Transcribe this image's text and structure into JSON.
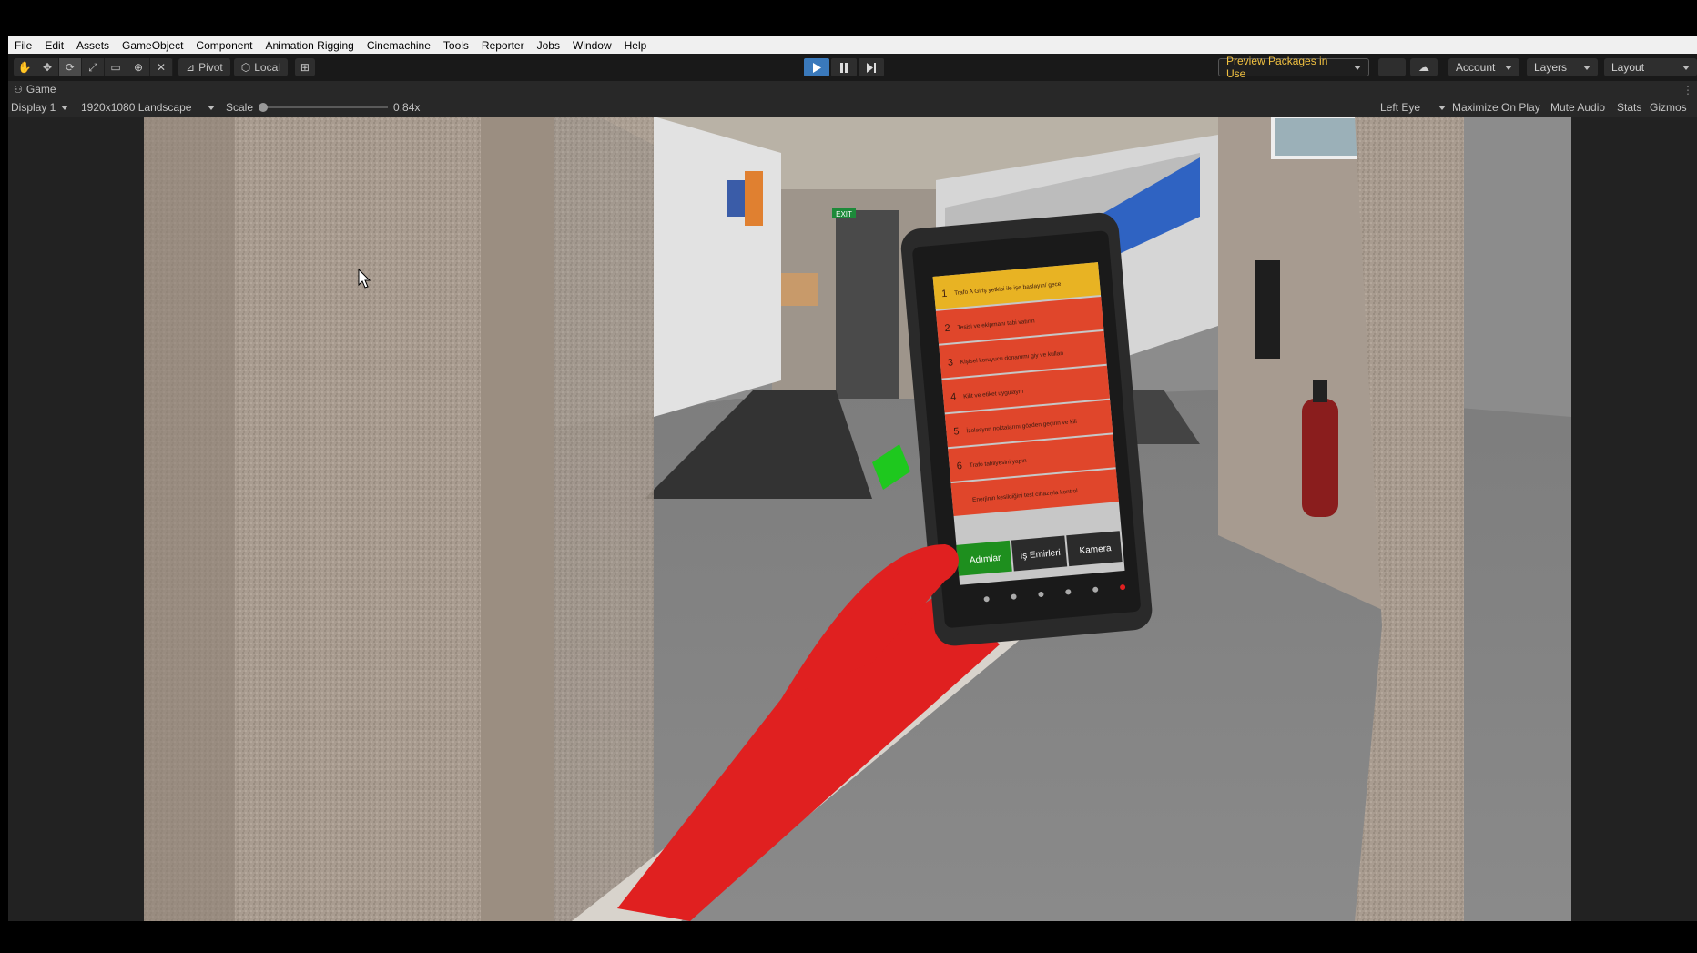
{
  "menu": [
    "File",
    "Edit",
    "Assets",
    "GameObject",
    "Component",
    "Animation Rigging",
    "Cinemachine",
    "Tools",
    "Reporter",
    "Jobs",
    "Window",
    "Help"
  ],
  "toolbar": {
    "pivot_label": "Pivot",
    "local_label": "Local",
    "preview_packages_label": "Preview Packages in Use",
    "account_label": "Account",
    "layers_label": "Layers",
    "layout_label": "Layout"
  },
  "game_tab": {
    "title": "Game"
  },
  "game_bar": {
    "display": "Display 1",
    "resolution": "1920x1080 Landscape",
    "scale_label": "Scale",
    "scale_value": "0.84x",
    "scale_fraction": 0.0,
    "eye": "Left Eye",
    "maximize": "Maximize On Play",
    "mute": "Mute Audio",
    "stats": "Stats",
    "gizmos": "Gizmos"
  },
  "tablet": {
    "steps": [
      {
        "num": "1",
        "text": "Trafo A Giriş yetkisi ile işe başlayın/ gecer",
        "status": "active"
      },
      {
        "num": "2",
        "text": "Tesisi ve ekipmanı tabi vatırın",
        "status": "pending"
      },
      {
        "num": "3",
        "text": "Kişisel koruyucu donanımı giy ve kullan",
        "status": "pending"
      },
      {
        "num": "4",
        "text": "Kilit ve etiket uygulayın",
        "status": "pending"
      },
      {
        "num": "5",
        "text": "İzolasyon noktalarını gözden geçirin ve kilitleyin",
        "status": "pending"
      },
      {
        "num": "6",
        "text": "Trafo tahliyesini yapın",
        "status": "pending"
      },
      {
        "num": "",
        "text": "Enerjinin kesildiğini test cihazıyla kontrol edin",
        "status": "pending"
      }
    ],
    "tabs": [
      "Adımlar",
      "İş Emirleri",
      "Kamera"
    ],
    "colors": {
      "active": "#e8b323",
      "pending": "#e0462b",
      "tab_active": "#1e8f1e"
    }
  },
  "scene": {
    "glove_color": "#e02020",
    "exit_sign": "EXIT"
  }
}
